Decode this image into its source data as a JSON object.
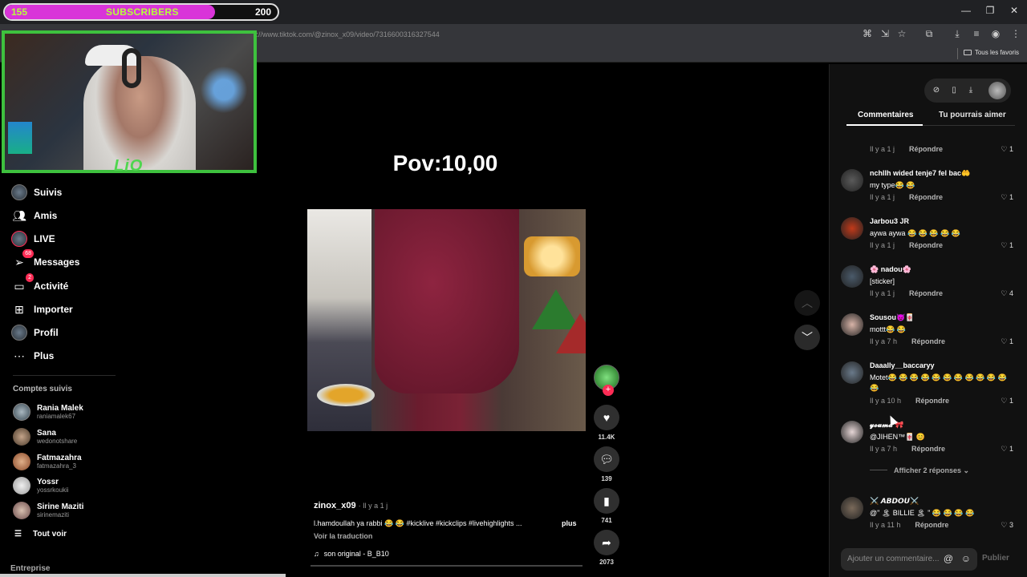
{
  "overlay": {
    "sub_left": "155",
    "sub_title": "SUBSCRIBERS",
    "sub_right": "200",
    "sub_progress": 0.77,
    "cam_label": "LiO"
  },
  "browser": {
    "url_hint": "https://www.tiktok.com/@zinox_x09/video/7316600316327544",
    "bookmarks_all": "Tous les favoris",
    "window_controls": [
      "—",
      "❐",
      "✕"
    ]
  },
  "nav": {
    "items": [
      {
        "label": "Suivis",
        "icon": "avatar-icon"
      },
      {
        "label": "Amis",
        "icon": "friends-icon"
      },
      {
        "label": "LIVE",
        "icon": "live-icon"
      },
      {
        "label": "Messages",
        "icon": "messages-icon",
        "badge": "68"
      },
      {
        "label": "Activité",
        "icon": "activity-icon",
        "badge": "2"
      },
      {
        "label": "Importer",
        "icon": "upload-icon"
      },
      {
        "label": "Profil",
        "icon": "profile-icon"
      },
      {
        "label": "Plus",
        "icon": "more-icon"
      }
    ],
    "followed_title": "Comptes suivis",
    "followed": [
      {
        "name": "Rania Malek",
        "handle": "raniamalek67"
      },
      {
        "name": "Sana",
        "handle": "wedonotshare"
      },
      {
        "name": "Fatmazahra",
        "handle": "fatmazahra_3"
      },
      {
        "name": "Yossr",
        "handle": "yossrkoukii"
      },
      {
        "name": "Sirine Maziti",
        "handle": "sirinemaziti"
      }
    ],
    "see_all": "Tout voir",
    "entreprise": "Entreprise"
  },
  "video": {
    "overlay_text": "Pov:10,00",
    "author": "zinox_x09",
    "time": "· Il y a 1 j",
    "caption": "l.hamdoullah ya rabbi 😂 😂 #kicklive #kickclips #livehighlights ...",
    "more": "plus",
    "translate": "Voir la traduction",
    "sound": "son original - B_B10",
    "likes": "11.4K",
    "comments": "139",
    "saves": "741",
    "shares": "2073"
  },
  "right": {
    "tabs": [
      "Commentaires",
      "Tu pourrais aimer"
    ],
    "comments": [
      {
        "name": "nchllh wided tenje7 fel bac🤲",
        "text": "my type😂 😂",
        "meta": "Il y a 1 j",
        "likes": "1",
        "color": "#5a5a5a"
      },
      {
        "name": "Jarbou3 JR",
        "text": "aywa aywa 😂 😂 😂 😂 😂",
        "meta": "Il y a 1 j",
        "likes": "1",
        "color": "#c23a1a"
      },
      {
        "name": "🌸 nadou🌸",
        "text": "[sticker]",
        "meta": "Il y a 1 j",
        "likes": "4",
        "color": "#4a5a6a"
      },
      {
        "name": "Sousou👿🀄",
        "text": "mottt😂 😂",
        "meta": "Il y a 7 h",
        "likes": "1",
        "color": "#d8b4a8"
      },
      {
        "name": "Daaally__baccaryy",
        "text": "Motet😂 😂 😂 😂 😂 😂 😂 😂 😂 😂 😂 😂",
        "meta": "Il y a 10 h",
        "likes": "1",
        "color": "#6a7a8a"
      },
      {
        "name": "𝔂𝓸𝓾𝓶𝓪 🎀",
        "text": "@JIHEN™🀄 😊",
        "meta": "Il y a 7 h",
        "likes": "1",
        "color": "#e6d6d6"
      },
      {
        "name": "⚔️ 𝘼𝘽𝘿𝙊𝙐⚔️",
        "text": "@\" 🏝 BILLIE 🏝 \" 😂 😂 😂 😂",
        "meta": "Il y a 11 h",
        "likes": "3",
        "color": "#7a6a5a"
      }
    ],
    "top_meta": "Il y a 1 j",
    "top_likes": "1",
    "reply_label": "Répondre",
    "show_replies": "Afficher 2 réponses",
    "compose_placeholder": "Ajouter un commentaire...",
    "publish": "Publier"
  },
  "colors": {
    "accent": "#fe2c55",
    "cam_border": "#3ec13e",
    "sub_fill": "#d934d9"
  }
}
